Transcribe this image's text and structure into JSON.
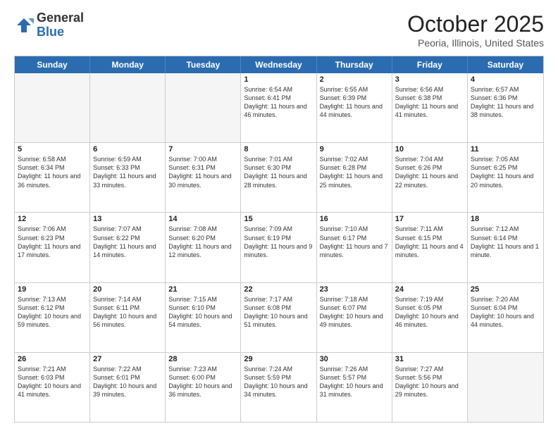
{
  "header": {
    "logo_line1": "General",
    "logo_line2": "Blue",
    "month": "October 2025",
    "location": "Peoria, Illinois, United States"
  },
  "weekdays": [
    "Sunday",
    "Monday",
    "Tuesday",
    "Wednesday",
    "Thursday",
    "Friday",
    "Saturday"
  ],
  "rows": [
    [
      {
        "day": "",
        "text": "",
        "empty": true
      },
      {
        "day": "",
        "text": "",
        "empty": true
      },
      {
        "day": "",
        "text": "",
        "empty": true
      },
      {
        "day": "1",
        "text": "Sunrise: 6:54 AM\nSunset: 6:41 PM\nDaylight: 11 hours and 46 minutes."
      },
      {
        "day": "2",
        "text": "Sunrise: 6:55 AM\nSunset: 6:39 PM\nDaylight: 11 hours and 44 minutes."
      },
      {
        "day": "3",
        "text": "Sunrise: 6:56 AM\nSunset: 6:38 PM\nDaylight: 11 hours and 41 minutes."
      },
      {
        "day": "4",
        "text": "Sunrise: 6:57 AM\nSunset: 6:36 PM\nDaylight: 11 hours and 38 minutes."
      }
    ],
    [
      {
        "day": "5",
        "text": "Sunrise: 6:58 AM\nSunset: 6:34 PM\nDaylight: 11 hours and 36 minutes."
      },
      {
        "day": "6",
        "text": "Sunrise: 6:59 AM\nSunset: 6:33 PM\nDaylight: 11 hours and 33 minutes."
      },
      {
        "day": "7",
        "text": "Sunrise: 7:00 AM\nSunset: 6:31 PM\nDaylight: 11 hours and 30 minutes."
      },
      {
        "day": "8",
        "text": "Sunrise: 7:01 AM\nSunset: 6:30 PM\nDaylight: 11 hours and 28 minutes."
      },
      {
        "day": "9",
        "text": "Sunrise: 7:02 AM\nSunset: 6:28 PM\nDaylight: 11 hours and 25 minutes."
      },
      {
        "day": "10",
        "text": "Sunrise: 7:04 AM\nSunset: 6:26 PM\nDaylight: 11 hours and 22 minutes."
      },
      {
        "day": "11",
        "text": "Sunrise: 7:05 AM\nSunset: 6:25 PM\nDaylight: 11 hours and 20 minutes."
      }
    ],
    [
      {
        "day": "12",
        "text": "Sunrise: 7:06 AM\nSunset: 6:23 PM\nDaylight: 11 hours and 17 minutes."
      },
      {
        "day": "13",
        "text": "Sunrise: 7:07 AM\nSunset: 6:22 PM\nDaylight: 11 hours and 14 minutes."
      },
      {
        "day": "14",
        "text": "Sunrise: 7:08 AM\nSunset: 6:20 PM\nDaylight: 11 hours and 12 minutes."
      },
      {
        "day": "15",
        "text": "Sunrise: 7:09 AM\nSunset: 6:19 PM\nDaylight: 11 hours and 9 minutes."
      },
      {
        "day": "16",
        "text": "Sunrise: 7:10 AM\nSunset: 6:17 PM\nDaylight: 11 hours and 7 minutes."
      },
      {
        "day": "17",
        "text": "Sunrise: 7:11 AM\nSunset: 6:15 PM\nDaylight: 11 hours and 4 minutes."
      },
      {
        "day": "18",
        "text": "Sunrise: 7:12 AM\nSunset: 6:14 PM\nDaylight: 11 hours and 1 minute."
      }
    ],
    [
      {
        "day": "19",
        "text": "Sunrise: 7:13 AM\nSunset: 6:12 PM\nDaylight: 10 hours and 59 minutes."
      },
      {
        "day": "20",
        "text": "Sunrise: 7:14 AM\nSunset: 6:11 PM\nDaylight: 10 hours and 56 minutes."
      },
      {
        "day": "21",
        "text": "Sunrise: 7:15 AM\nSunset: 6:10 PM\nDaylight: 10 hours and 54 minutes."
      },
      {
        "day": "22",
        "text": "Sunrise: 7:17 AM\nSunset: 6:08 PM\nDaylight: 10 hours and 51 minutes."
      },
      {
        "day": "23",
        "text": "Sunrise: 7:18 AM\nSunset: 6:07 PM\nDaylight: 10 hours and 49 minutes."
      },
      {
        "day": "24",
        "text": "Sunrise: 7:19 AM\nSunset: 6:05 PM\nDaylight: 10 hours and 46 minutes."
      },
      {
        "day": "25",
        "text": "Sunrise: 7:20 AM\nSunset: 6:04 PM\nDaylight: 10 hours and 44 minutes."
      }
    ],
    [
      {
        "day": "26",
        "text": "Sunrise: 7:21 AM\nSunset: 6:03 PM\nDaylight: 10 hours and 41 minutes."
      },
      {
        "day": "27",
        "text": "Sunrise: 7:22 AM\nSunset: 6:01 PM\nDaylight: 10 hours and 39 minutes."
      },
      {
        "day": "28",
        "text": "Sunrise: 7:23 AM\nSunset: 6:00 PM\nDaylight: 10 hours and 36 minutes."
      },
      {
        "day": "29",
        "text": "Sunrise: 7:24 AM\nSunset: 5:59 PM\nDaylight: 10 hours and 34 minutes."
      },
      {
        "day": "30",
        "text": "Sunrise: 7:26 AM\nSunset: 5:57 PM\nDaylight: 10 hours and 31 minutes."
      },
      {
        "day": "31",
        "text": "Sunrise: 7:27 AM\nSunset: 5:56 PM\nDaylight: 10 hours and 29 minutes."
      },
      {
        "day": "",
        "text": "",
        "empty": true
      }
    ]
  ]
}
